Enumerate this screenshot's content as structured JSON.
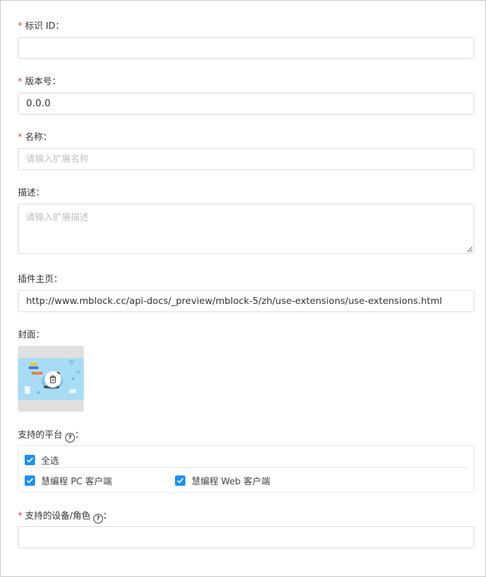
{
  "fields": {
    "id": {
      "required": "*",
      "label": "标识 ID：",
      "value": ""
    },
    "version": {
      "required": "*",
      "label": "版本号：",
      "value": "0.0.0"
    },
    "name": {
      "required": "*",
      "label": "名称：",
      "placeholder": "请输入扩展名称"
    },
    "description": {
      "label": "描述：",
      "placeholder": "请输入扩展描述"
    },
    "homepage": {
      "label": "插件主页：",
      "value": "http://www.mblock.cc/api-docs/_preview/mblock-5/zh/use-extensions/use-extensions.html"
    },
    "cover": {
      "label": "封面："
    },
    "platforms": {
      "label": "支持的平台",
      "label_suffix": "：",
      "help_icon": "?",
      "select_all": {
        "label": "全选",
        "checked": true
      },
      "options": [
        {
          "label": "慧编程 PC 客户端",
          "checked": true
        },
        {
          "label": "慧编程 Web 客户端",
          "checked": true
        }
      ]
    },
    "devices": {
      "required": "*",
      "label": "支持的设备/角色",
      "label_suffix": "：",
      "help_icon": "?",
      "value": ""
    }
  },
  "colors": {
    "required": "#e5363b",
    "checkbox": "#1890ff",
    "border": "#d9d9d9"
  }
}
